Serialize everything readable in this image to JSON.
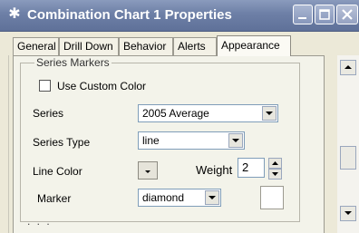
{
  "window": {
    "title": "Combination Chart 1 Properties",
    "title_icon": "snowflake-icon"
  },
  "tabs": [
    {
      "label": "General"
    },
    {
      "label": "Drill Down"
    },
    {
      "label": "Behavior"
    },
    {
      "label": "Alerts"
    },
    {
      "label": "Appearance"
    }
  ],
  "active_tab": "Appearance",
  "group": {
    "label": "Series Markers"
  },
  "custom_color": {
    "label": "Use Custom Color",
    "checked": false
  },
  "series": {
    "label": "Series",
    "value": "2005 Average"
  },
  "series_type": {
    "label": "Series Type",
    "value": "line"
  },
  "line_color": {
    "label": "Line Color"
  },
  "weight": {
    "label": "Weight",
    "value": "2"
  },
  "marker": {
    "label": "Marker",
    "value": "diamond"
  },
  "footer": {
    "ellipsis": ". . ."
  }
}
